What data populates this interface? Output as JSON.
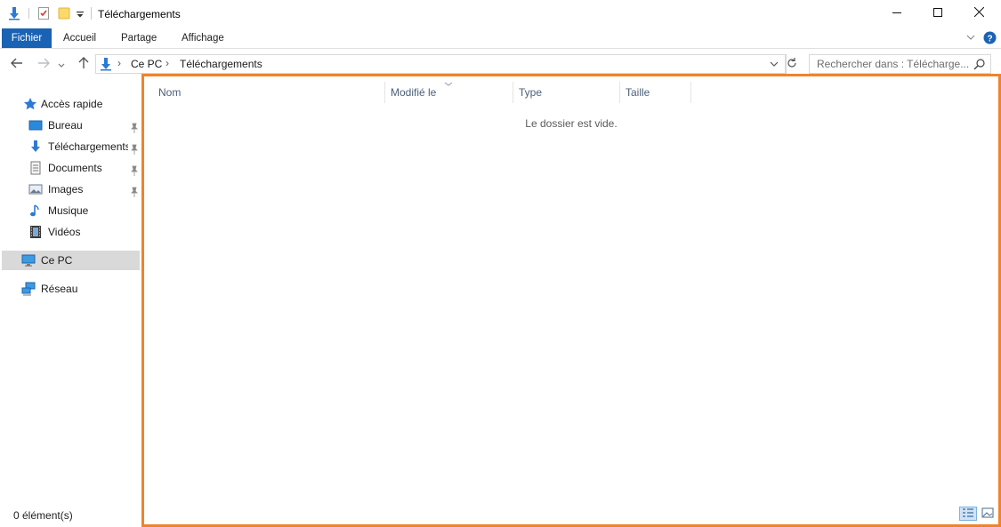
{
  "window": {
    "title": "Téléchargements"
  },
  "ribbon": {
    "tabs": [
      {
        "label": "Fichier"
      },
      {
        "label": "Accueil"
      },
      {
        "label": "Partage"
      },
      {
        "label": "Affichage"
      }
    ]
  },
  "address": {
    "breadcrumb": [
      "Ce PC",
      "Téléchargements"
    ]
  },
  "search": {
    "placeholder": "Rechercher dans : Télécharge..."
  },
  "sidebar": {
    "quick_access": "Accès rapide",
    "items": [
      {
        "label": "Bureau",
        "icon": "desktop-icon"
      },
      {
        "label": "Téléchargements",
        "icon": "download-arrow-icon"
      },
      {
        "label": "Documents",
        "icon": "documents-icon"
      },
      {
        "label": "Images",
        "icon": "images-icon"
      },
      {
        "label": "Musique",
        "icon": "music-note-icon"
      },
      {
        "label": "Vidéos",
        "icon": "film-icon"
      }
    ],
    "this_pc": "Ce PC",
    "network": "Réseau"
  },
  "content": {
    "columns": [
      {
        "label": "Nom"
      },
      {
        "label": "Modifié le"
      },
      {
        "label": "Type"
      },
      {
        "label": "Taille"
      }
    ],
    "empty_message": "Le dossier est vide."
  },
  "status": {
    "count": "0 élément(s)"
  },
  "colors": {
    "accent": "#1a62b4",
    "highlight_border": "#f0832a",
    "selected_nav": "#d9d9d9"
  }
}
